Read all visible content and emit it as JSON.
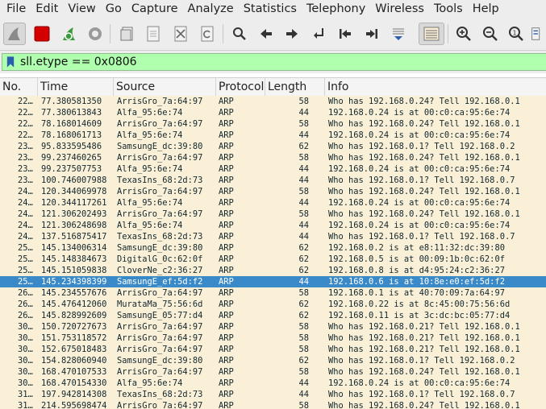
{
  "menu": [
    "File",
    "Edit",
    "View",
    "Go",
    "Capture",
    "Analyze",
    "Statistics",
    "Telephony",
    "Wireless",
    "Tools",
    "Help"
  ],
  "toolbar": {
    "icons": [
      "shark-fin-start-icon",
      "stop-capture-icon",
      "restart-capture-icon",
      "capture-options-icon",
      "open-file-icon",
      "save-file-icon",
      "close-file-icon",
      "reload-file-icon",
      "find-packet-icon",
      "go-back-icon",
      "go-forward-icon",
      "go-to-packet-icon",
      "go-first-packet-icon",
      "go-last-packet-icon",
      "autoscroll-icon",
      "colorize-icon",
      "zoom-in-icon",
      "zoom-out-icon",
      "normal-size-icon",
      "resize-columns-icon"
    ]
  },
  "filter": {
    "text": "sll.etype == 0x0806",
    "bg_color": "#afffaf"
  },
  "columns": [
    "No.",
    "Time",
    "Source",
    "Protocol",
    "Length",
    "Info"
  ],
  "colors": {
    "arp_row": "#faf0d7",
    "selected_row": "#3a89c8"
  },
  "rows": [
    {
      "no": "22…",
      "time": "77.380581350",
      "source": "ArrisGro_7a:64:97",
      "protocol": "ARP",
      "length": "58",
      "info": "Who has 192.168.0.24? Tell 192.168.0.1"
    },
    {
      "no": "22…",
      "time": "77.380613843",
      "source": "Alfa_95:6e:74",
      "protocol": "ARP",
      "length": "44",
      "info": "192.168.0.24 is at 00:c0:ca:95:6e:74"
    },
    {
      "no": "22…",
      "time": "78.168014609",
      "source": "ArrisGro_7a:64:97",
      "protocol": "ARP",
      "length": "58",
      "info": "Who has 192.168.0.24? Tell 192.168.0.1"
    },
    {
      "no": "22…",
      "time": "78.168061713",
      "source": "Alfa_95:6e:74",
      "protocol": "ARP",
      "length": "44",
      "info": "192.168.0.24 is at 00:c0:ca:95:6e:74"
    },
    {
      "no": "23…",
      "time": "95.833595486",
      "source": "SamsungE_dc:39:80",
      "protocol": "ARP",
      "length": "62",
      "info": "Who has 192.168.0.1? Tell 192.168.0.2"
    },
    {
      "no": "23…",
      "time": "99.237460265",
      "source": "ArrisGro_7a:64:97",
      "protocol": "ARP",
      "length": "58",
      "info": "Who has 192.168.0.24? Tell 192.168.0.1"
    },
    {
      "no": "23…",
      "time": "99.237507753",
      "source": "Alfa_95:6e:74",
      "protocol": "ARP",
      "length": "44",
      "info": "192.168.0.24 is at 00:c0:ca:95:6e:74"
    },
    {
      "no": "23…",
      "time": "100.746007988",
      "source": "TexasIns_68:2d:73",
      "protocol": "ARP",
      "length": "44",
      "info": "Who has 192.168.0.1? Tell 192.168.0.7"
    },
    {
      "no": "24…",
      "time": "120.344069978",
      "source": "ArrisGro_7a:64:97",
      "protocol": "ARP",
      "length": "58",
      "info": "Who has 192.168.0.24? Tell 192.168.0.1"
    },
    {
      "no": "24…",
      "time": "120.344117261",
      "source": "Alfa_95:6e:74",
      "protocol": "ARP",
      "length": "44",
      "info": "192.168.0.24 is at 00:c0:ca:95:6e:74"
    },
    {
      "no": "24…",
      "time": "121.306202493",
      "source": "ArrisGro_7a:64:97",
      "protocol": "ARP",
      "length": "58",
      "info": "Who has 192.168.0.24? Tell 192.168.0.1"
    },
    {
      "no": "24…",
      "time": "121.306248698",
      "source": "Alfa_95:6e:74",
      "protocol": "ARP",
      "length": "44",
      "info": "192.168.0.24 is at 00:c0:ca:95:6e:74"
    },
    {
      "no": "24…",
      "time": "137.516875417",
      "source": "TexasIns_68:2d:73",
      "protocol": "ARP",
      "length": "44",
      "info": "Who has 192.168.0.1? Tell 192.168.0.7"
    },
    {
      "no": "25…",
      "time": "145.134006314",
      "source": "SamsungE_dc:39:80",
      "protocol": "ARP",
      "length": "62",
      "info": "192.168.0.2 is at e8:11:32:dc:39:80"
    },
    {
      "no": "25…",
      "time": "145.148384673",
      "source": "DigitalG_0c:62:0f",
      "protocol": "ARP",
      "length": "62",
      "info": "192.168.0.5 is at 00:09:1b:0c:62:0f"
    },
    {
      "no": "25…",
      "time": "145.151059838",
      "source": "CloverNe_c2:36:27",
      "protocol": "ARP",
      "length": "62",
      "info": "192.168.0.8 is at d4:95:24:c2:36:27"
    },
    {
      "no": "25…",
      "time": "145.234398399",
      "source": "SamsungE_ef:5d:f2",
      "protocol": "ARP",
      "length": "44",
      "info": "192.168.0.6 is at 10:8e:e0:ef:5d:f2",
      "selected": true
    },
    {
      "no": "26…",
      "time": "145.234557676",
      "source": "ArrisGro_7a:64:97",
      "protocol": "ARP",
      "length": "58",
      "info": "192.168.0.1 is at 40:70:09:7a:64:97"
    },
    {
      "no": "26…",
      "time": "145.476412060",
      "source": "MurataMa_75:56:6d",
      "protocol": "ARP",
      "length": "62",
      "info": "192.168.0.22 is at 8c:45:00:75:56:6d"
    },
    {
      "no": "26…",
      "time": "145.828992609",
      "source": "SamsungE_05:77:d4",
      "protocol": "ARP",
      "length": "62",
      "info": "192.168.0.11 is at 3c:dc:bc:05:77:d4"
    },
    {
      "no": "30…",
      "time": "150.720727673",
      "source": "ArrisGro_7a:64:97",
      "protocol": "ARP",
      "length": "58",
      "info": "Who has 192.168.0.21? Tell 192.168.0.1"
    },
    {
      "no": "30…",
      "time": "151.753118572",
      "source": "ArrisGro_7a:64:97",
      "protocol": "ARP",
      "length": "58",
      "info": "Who has 192.168.0.21? Tell 192.168.0.1"
    },
    {
      "no": "30…",
      "time": "152.675018483",
      "source": "ArrisGro_7a:64:97",
      "protocol": "ARP",
      "length": "58",
      "info": "Who has 192.168.0.21? Tell 192.168.0.1"
    },
    {
      "no": "30…",
      "time": "154.828060940",
      "source": "SamsungE_dc:39:80",
      "protocol": "ARP",
      "length": "62",
      "info": "Who has 192.168.0.1? Tell 192.168.0.2"
    },
    {
      "no": "30…",
      "time": "168.470107533",
      "source": "ArrisGro_7a:64:97",
      "protocol": "ARP",
      "length": "58",
      "info": "Who has 192.168.0.24? Tell 192.168.0.1"
    },
    {
      "no": "30…",
      "time": "168.470154330",
      "source": "Alfa_95:6e:74",
      "protocol": "ARP",
      "length": "44",
      "info": "192.168.0.24 is at 00:c0:ca:95:6e:74"
    },
    {
      "no": "31…",
      "time": "197.942814308",
      "source": "TexasIns_68:2d:73",
      "protocol": "ARP",
      "length": "44",
      "info": "Who has 192.168.0.1? Tell 192.168.0.7"
    },
    {
      "no": "31…",
      "time": "214.595698474",
      "source": "ArrisGro_7a:64:97",
      "protocol": "ARP",
      "length": "58",
      "info": "Who has 192.168.0.24? Tell 192.168.0.1"
    }
  ]
}
